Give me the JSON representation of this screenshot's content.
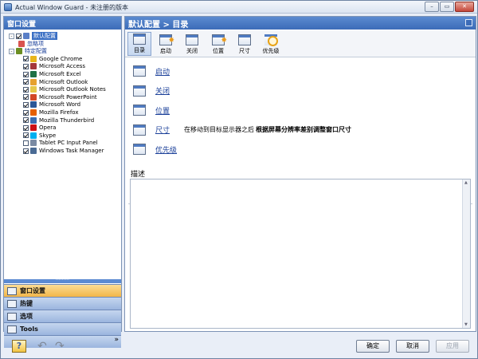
{
  "window": {
    "title": "Actual Window Guard - 未注册的版本",
    "buttons": {
      "minimize": "–",
      "restore": "▭",
      "close": "✕"
    }
  },
  "left": {
    "header": "窗口设置",
    "tree": [
      {
        "label": "默认配置",
        "level": 0,
        "checkbox": true,
        "checked": true,
        "expander": "-",
        "selected": true,
        "icon": "#5a7fc7"
      },
      {
        "label": "忽略项",
        "level": 1,
        "checkbox": false,
        "link": true,
        "icon": "#d9534f"
      },
      {
        "label": "特定配置",
        "level": 0,
        "checkbox": false,
        "expander": "-",
        "link": true,
        "icon": "#6b8e23"
      },
      {
        "label": "Google Chrome",
        "level": 2,
        "checkbox": true,
        "checked": true,
        "icon": "#e8b51c"
      },
      {
        "label": "Microsoft Access",
        "level": 2,
        "checkbox": true,
        "checked": true,
        "icon": "#a4373a"
      },
      {
        "label": "Microsoft Excel",
        "level": 2,
        "checkbox": true,
        "checked": true,
        "icon": "#1e7145"
      },
      {
        "label": "Microsoft Outlook",
        "level": 2,
        "checkbox": true,
        "checked": true,
        "icon": "#e6a12f"
      },
      {
        "label": "Microsoft Outlook Notes",
        "level": 2,
        "checkbox": true,
        "checked": true,
        "icon": "#e6c84a"
      },
      {
        "label": "Microsoft PowerPoint",
        "level": 2,
        "checkbox": true,
        "checked": true,
        "icon": "#d24726"
      },
      {
        "label": "Microsoft Word",
        "level": 2,
        "checkbox": true,
        "checked": true,
        "icon": "#2b5797"
      },
      {
        "label": "Mozilla Firefox",
        "level": 2,
        "checkbox": true,
        "checked": true,
        "icon": "#e66000"
      },
      {
        "label": "Mozilla Thunderbird",
        "level": 2,
        "checkbox": true,
        "checked": true,
        "icon": "#3a6cb2"
      },
      {
        "label": "Opera",
        "level": 2,
        "checkbox": true,
        "checked": true,
        "icon": "#cc0f16"
      },
      {
        "label": "Skype",
        "level": 2,
        "checkbox": true,
        "checked": true,
        "icon": "#00aff0"
      },
      {
        "label": "Tablet PC Input Panel",
        "level": 2,
        "checkbox": true,
        "checked": false,
        "icon": "#7a8aa3"
      },
      {
        "label": "Windows Task Manager",
        "level": 2,
        "checkbox": true,
        "checked": true,
        "icon": "#4a6b95"
      }
    ],
    "nav": [
      {
        "label": "窗口设置",
        "active": true,
        "icon": "window-settings-icon"
      },
      {
        "label": "热键",
        "active": false,
        "icon": "keyboard-icon"
      },
      {
        "label": "选项",
        "active": false,
        "icon": "options-icon"
      },
      {
        "label": "Tools",
        "active": false,
        "icon": "tools-icon"
      }
    ],
    "grip": "·········",
    "footer_chevron": "»"
  },
  "right": {
    "header": "默认配置 > 目录",
    "toolbar": [
      {
        "label": "目录",
        "active": true
      },
      {
        "label": "启动",
        "active": false
      },
      {
        "label": "关闭",
        "active": false
      },
      {
        "label": "位置",
        "active": false
      },
      {
        "label": "尺寸",
        "active": false
      },
      {
        "label": "优先级",
        "active": false
      }
    ],
    "rows": [
      {
        "link": "启动"
      },
      {
        "link": "关闭"
      },
      {
        "link": "位置"
      },
      {
        "link": "尺寸",
        "desc": "在移动到目标显示器之后",
        "bold": "根据屏幕分辨率差别调整窗口尺寸"
      },
      {
        "link": "优先级"
      }
    ],
    "description_label": "描述"
  },
  "bottom": {
    "ok": "确定",
    "cancel": "取消",
    "apply": "应用"
  }
}
